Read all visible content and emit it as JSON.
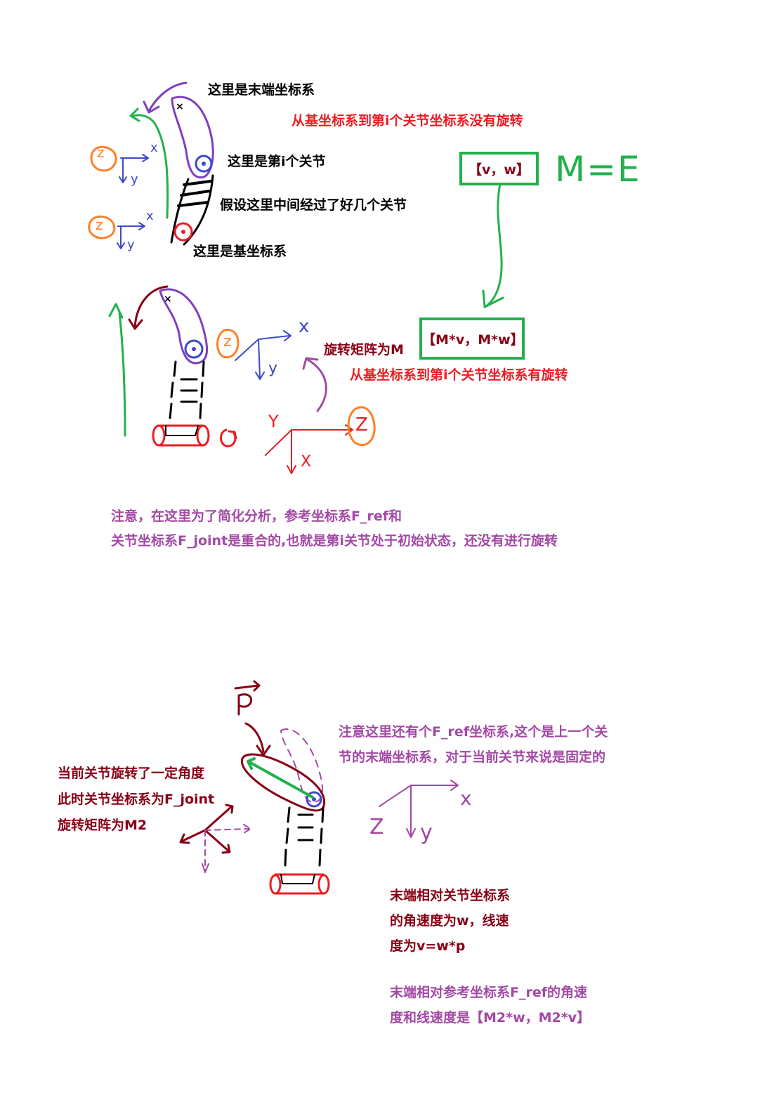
{
  "colors": {
    "black": "#000000",
    "red": "#ed1c24",
    "dark_red": "#880015",
    "purple": "#7f3fbf",
    "green": "#22b14c",
    "blue": "#3f48cc",
    "orange": "#ff7f27",
    "note_purple": "#a349a4"
  },
  "top_diagram": {
    "label_end_frame": "这里是末端坐标系",
    "label_no_rotation": "从基坐标系到第i个关节坐标系没有旋转",
    "label_joint_i": "这里是第i个关节",
    "label_intermediate": "假设这里中间经过了好几个关节",
    "label_base_frame": "这里是基坐标系",
    "box_v_w": "【v，w】",
    "m_equals_e": "M=E",
    "box_mv_mw": "【M*v，M*w】",
    "label_rotation_matrix": "旋转矩阵为M",
    "label_with_rotation": "从基坐标系到第i个关节坐标系有旋转",
    "axis_x": "x",
    "axis_y": "y",
    "axis_z": "z",
    "axis_x_upper": "X",
    "axis_y_upper": "Y",
    "axis_z_upper": "Z"
  },
  "note1": {
    "line1": "注意，在这里为了简化分析，参考坐标系F_ref和",
    "line2": "关节坐标系F_joint是重合的,也就是第i关节处于初始状态，还没有进行旋转"
  },
  "bottom_diagram": {
    "vector_p": "P",
    "ref_note_line1": "注意这里还有个F_ref坐标系,这个是上一个关",
    "ref_note_line2": "节的末端坐标系，对于当前关节来说是固定的",
    "left_line1": "当前关节旋转了一定角度",
    "left_line2": "此时关节坐标系为F_joint",
    "left_line3": "旋转矩阵为M2",
    "rel_line1": "末端相对关节坐标系",
    "rel_line2": "的角速度为w，线速",
    "rel_line3": "度为v=w*p",
    "ref_line1": "末端相对参考坐标系F_ref的角速",
    "ref_line2": "度和线速度是【M2*w，M2*v】",
    "axis_x": "x",
    "axis_y": "y",
    "axis_z": "Z"
  }
}
